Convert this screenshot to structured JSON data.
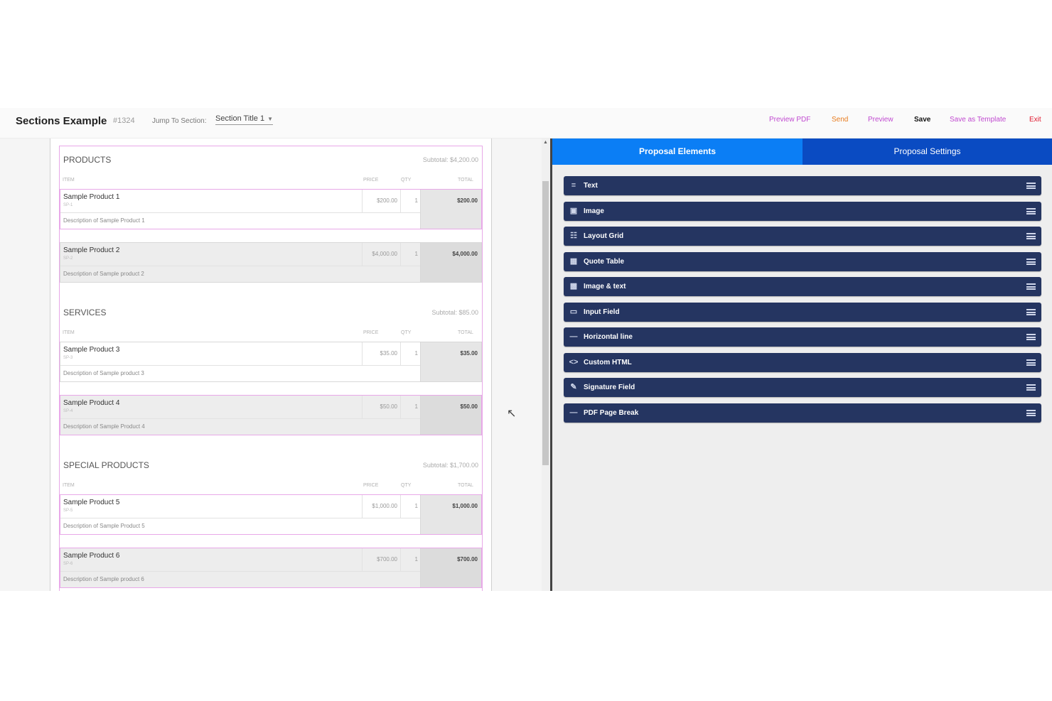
{
  "header": {
    "title": "Sections Example",
    "number": "#1324",
    "jump_label": "Jump To Section:",
    "jump_value": "Section Title 1",
    "actions": {
      "preview_pdf": "Preview PDF",
      "send": "Send",
      "preview": "Preview",
      "save": "Save",
      "save_template": "Save as Template",
      "exit": "Exit"
    }
  },
  "columns": {
    "item": "ITEM",
    "price": "PRICE",
    "qty": "QTY",
    "total": "TOTAL"
  },
  "sections": [
    {
      "title": "PRODUCTS",
      "subtotal": "Subtotal: $4,200.00",
      "rows": [
        {
          "name": "Sample Product 1",
          "sku": "SP-1",
          "desc": "Description of Sample Product 1",
          "price": "$200.00",
          "qty": "1",
          "total": "$200.00"
        },
        {
          "name": "Sample Product 2",
          "sku": "SP-2",
          "desc": "Description of Sample product 2",
          "price": "$4,000.00",
          "qty": "1",
          "total": "$4,000.00"
        }
      ]
    },
    {
      "title": "SERVICES",
      "subtotal": "Subtotal: $85.00",
      "rows": [
        {
          "name": "Sample Product 3",
          "sku": "SP-3",
          "desc": "Description of Sample product 3",
          "price": "$35.00",
          "qty": "1",
          "total": "$35.00"
        },
        {
          "name": "Sample Product 4",
          "sku": "SP-4",
          "desc": "Description of Sample Product 4",
          "price": "$50.00",
          "qty": "1",
          "total": "$50.00"
        }
      ]
    },
    {
      "title": "SPECIAL PRODUCTS",
      "subtotal": "Subtotal: $1,700.00",
      "rows": [
        {
          "name": "Sample Product 5",
          "sku": "SP-5",
          "desc": "Description of Sample Product 5",
          "price": "$1,000.00",
          "qty": "1",
          "total": "$1,000.00"
        },
        {
          "name": "Sample Product 6",
          "sku": "SP-6",
          "desc": "Description of Sample product 6",
          "price": "$700.00",
          "qty": "1",
          "total": "$700.00"
        }
      ]
    }
  ],
  "panel": {
    "tabs": [
      "Proposal Elements",
      "Proposal Settings"
    ],
    "elements": [
      {
        "label": "Text",
        "icon": "text-icon"
      },
      {
        "label": "Image",
        "icon": "image-icon"
      },
      {
        "label": "Layout Grid",
        "icon": "grid-icon"
      },
      {
        "label": "Quote Table",
        "icon": "table-icon"
      },
      {
        "label": "Image & text",
        "icon": "image-text-icon"
      },
      {
        "label": "Input Field",
        "icon": "input-icon"
      },
      {
        "label": "Horizontal line",
        "icon": "line-icon"
      },
      {
        "label": "Custom HTML",
        "icon": "code-icon"
      },
      {
        "label": "Signature Field",
        "icon": "signature-icon"
      },
      {
        "label": "PDF Page Break",
        "icon": "page-break-icon"
      }
    ]
  }
}
